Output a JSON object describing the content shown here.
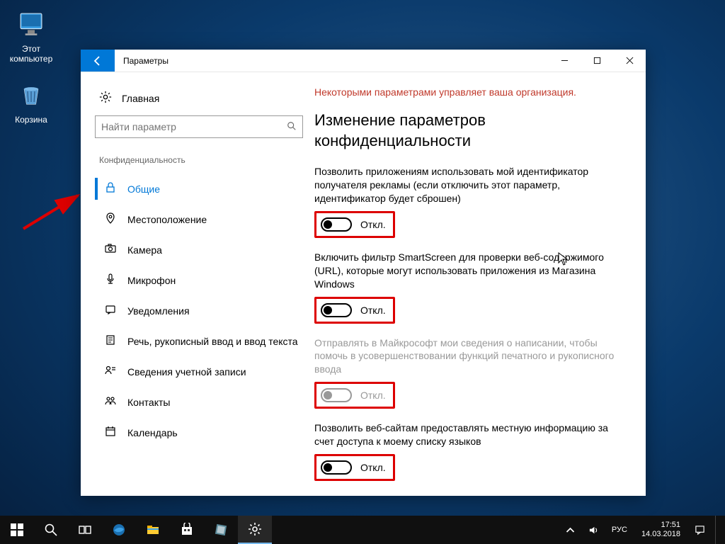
{
  "desktop": {
    "icons": {
      "pc": "Этот компьютер",
      "bin": "Корзина"
    }
  },
  "window": {
    "title": "Параметры",
    "home": "Главная",
    "search_placeholder": "Найти параметр",
    "group": "Конфиденциальность",
    "nav": [
      {
        "label": "Общие"
      },
      {
        "label": "Местоположение"
      },
      {
        "label": "Камера"
      },
      {
        "label": "Микрофон"
      },
      {
        "label": "Уведомления"
      },
      {
        "label": "Речь, рукописный ввод и ввод текста"
      },
      {
        "label": "Сведения учетной записи"
      },
      {
        "label": "Контакты"
      },
      {
        "label": "Календарь"
      }
    ],
    "content": {
      "org_msg": "Некоторыми параметрами управляет ваша организация.",
      "heading": "Изменение параметров конфиденциальности",
      "settings": [
        {
          "desc": "Позволить приложениям использовать мой идентификатор получателя рекламы (если отключить этот параметр, идентификатор будет сброшен)",
          "state": "Откл.",
          "disabled": false
        },
        {
          "desc": "Включить фильтр SmartScreen для проверки веб-содержимого (URL), которые могут использовать приложения из Магазина Windows",
          "state": "Откл.",
          "disabled": false
        },
        {
          "desc": "Отправлять в Майкрософт мои сведения о написании, чтобы помочь в усовершенствовании функций печатного и рукописного ввода",
          "state": "Откл.",
          "disabled": true
        },
        {
          "desc": "Позволить веб-сайтам предоставлять местную информацию за счет доступа к моему списку языков",
          "state": "Откл.",
          "disabled": false
        }
      ]
    }
  },
  "taskbar": {
    "lang": "РУС",
    "time": "17:51",
    "date": "14.03.2018"
  }
}
